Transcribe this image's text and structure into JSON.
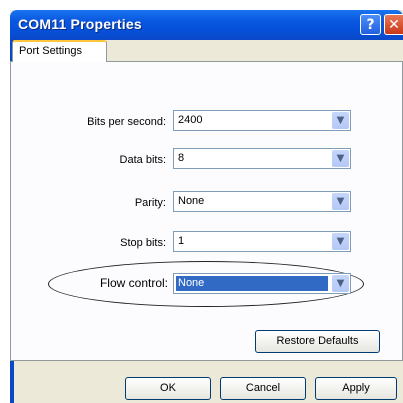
{
  "window": {
    "title": "COM11 Properties",
    "help_glyph": "?",
    "close_glyph": "✕"
  },
  "tabs": [
    {
      "label": "Port Settings"
    }
  ],
  "fields": {
    "bits_per_second": {
      "label": "Bits per second:",
      "value": "2400"
    },
    "data_bits": {
      "label": "Data bits:",
      "value": "8"
    },
    "parity": {
      "label": "Parity:",
      "value": "None"
    },
    "stop_bits": {
      "label": "Stop bits:",
      "value": "1"
    },
    "flow_control": {
      "label": "Flow control:",
      "value": "None"
    }
  },
  "buttons": {
    "restore_defaults": "Restore Defaults",
    "ok": "OK",
    "cancel": "Cancel",
    "apply": "Apply"
  },
  "icons": {
    "dropdown": "chevron-down-icon"
  },
  "colors": {
    "titlebar": "#0a58e0",
    "selection": "#316ac5",
    "tab_accent": "#ffc73c"
  }
}
